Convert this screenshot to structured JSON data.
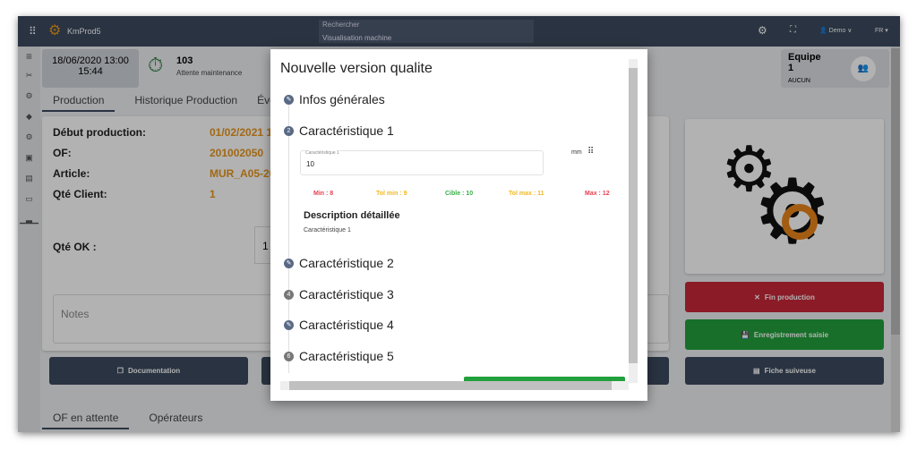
{
  "header": {
    "app_name": "KmProd5",
    "search_label": "Rechercher",
    "search_value": "Visualisation machine",
    "user": "Demo",
    "lang": "FR"
  },
  "info": {
    "datetime": "18/06/2020 13:00",
    "time": "15:44",
    "status_code": "103",
    "status_text": "Attente maintenance",
    "team_label": "Equipe",
    "team_value": "1",
    "team_sub": "AUCUN"
  },
  "tabs": [
    "Production",
    "Historique Production",
    "Événements"
  ],
  "production": {
    "rows": [
      {
        "label": "Début production:",
        "value": "01/02/2021 1"
      },
      {
        "label": "OF:",
        "value": "201002050"
      },
      {
        "label": "Article:",
        "value": "MUR_A05-20"
      },
      {
        "label": "Qté Client:",
        "value": "1"
      }
    ],
    "qty_ok_label": "Qté OK :",
    "qty_ok_value": "1",
    "notes_placeholder": "Notes"
  },
  "buttons": {
    "documentation": "Documentation",
    "fin_production": "Fin production",
    "enregistrement": "Enregistrement saisie",
    "fiche": "Fiche suiveuse"
  },
  "bottom_tabs": [
    "OF en attente",
    "Opérateurs"
  ],
  "colors": {
    "header": "#3c4a5e",
    "accent": "#e8961c",
    "red": "#c62838",
    "green": "#22a03c",
    "navy": "#3c4a5e"
  },
  "modal": {
    "title": "Nouvelle version qualite",
    "steps": [
      {
        "label": "Infos générales",
        "icon": "pencil-icon"
      },
      {
        "label": "Caractéristique 1",
        "num": "2"
      },
      {
        "label": "Caractéristique 2",
        "icon": "pencil-icon"
      },
      {
        "label": "Caractéristique 3",
        "num": "4"
      },
      {
        "label": "Caractéristique 4",
        "icon": "pencil-icon"
      },
      {
        "label": "Caractéristique 5",
        "num": "6"
      }
    ],
    "field_label": "Caractéristique 1",
    "field_value": "10",
    "unit": "mm",
    "limits": {
      "min": "Min : 8",
      "tol_min": "Tol min : 9",
      "cible": "Cible : 10",
      "tol_max": "Tol max : 11",
      "max": "Max : 12"
    },
    "desc_title": "Description détaillée",
    "desc_text": "Caractéristique 1"
  }
}
